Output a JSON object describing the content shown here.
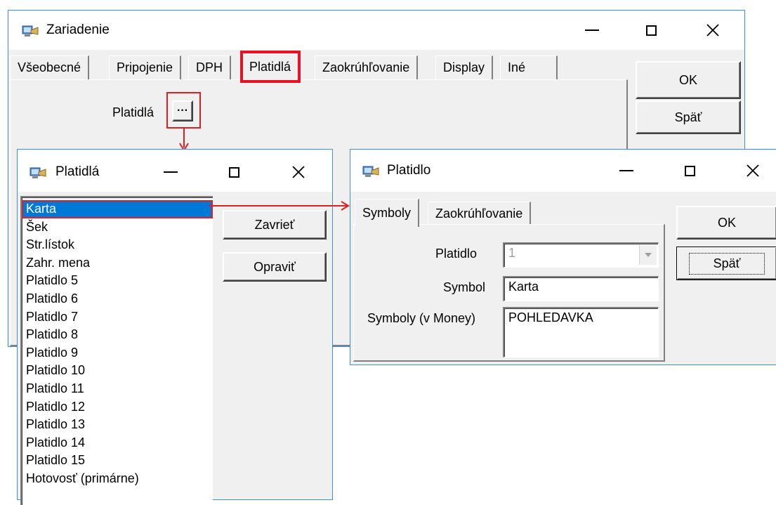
{
  "zariadenie": {
    "title": "Zariadenie",
    "tabs": [
      "Všeobecné",
      "Pripojenie",
      "DPH",
      "Platidlá",
      "Zaokrúhľovanie",
      "Display",
      "Iné"
    ],
    "active_tab": "Platidlá",
    "platidla_label": "Platidlá",
    "ellipsis": "···",
    "ok_label": "OK",
    "spat_label": "Späť"
  },
  "platidla_window": {
    "title": "Platidlá",
    "items": [
      "Karta",
      "Šek",
      "Str.lístok",
      "Zahr. mena",
      "Platidlo 5",
      "Platidlo 6",
      "Platidlo 7",
      "Platidlo 8",
      "Platidlo 9",
      "Platidlo 10",
      "Platidlo 11",
      "Platidlo 12",
      "Platidlo 13",
      "Platidlo 14",
      "Platidlo 15",
      "Hotovosť (primárne)"
    ],
    "selected": "Karta",
    "zavriet_label": "Zavrieť",
    "opravit_label": "Opraviť"
  },
  "platidlo_window": {
    "title": "Platidlo",
    "tabs": [
      "Symboly",
      "Zaokrúhľovanie"
    ],
    "active_tab": "Symboly",
    "platidlo_label": "Platidlo",
    "platidlo_value": "1",
    "symbol_label": "Symbol",
    "symbol_value": "Karta",
    "symboly_label": "Symboly (v Money)",
    "symboly_value": "POHLEDAVKA",
    "ok_label": "OK",
    "spat_label": "Späť"
  },
  "colors": {
    "window_border": "#3c8fd8",
    "highlight_red": "#e81123",
    "annotation_red": "#e02020",
    "selection": "#0078d7"
  },
  "icons": [
    "computer-app-icon",
    "minimize-icon",
    "maximize-icon",
    "close-icon",
    "dropdown-arrow-icon"
  ]
}
